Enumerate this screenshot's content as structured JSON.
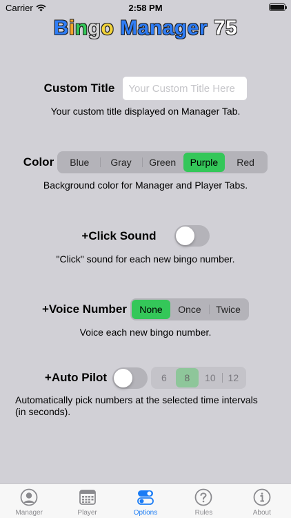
{
  "status_bar": {
    "carrier": "Carrier",
    "time": "2:58 PM"
  },
  "app_title": {
    "word1_letters": [
      {
        "char": "B",
        "color": "#2f7df6"
      },
      {
        "char": "i",
        "color": "#f4a52b"
      },
      {
        "char": "n",
        "color": "#34c759"
      },
      {
        "char": "g",
        "color": "#d5d5d5"
      },
      {
        "char": "o",
        "color": "#f2d33a"
      }
    ],
    "word2": "Manager",
    "word2_color": "#2f7df6",
    "number": "75"
  },
  "custom_title": {
    "label": "Custom Title",
    "placeholder": "Your Custom Title Here",
    "value": "",
    "description": "Your custom title displayed on Manager Tab."
  },
  "color": {
    "label": "Color",
    "options": [
      "Blue",
      "Gray",
      "Green",
      "Purple",
      "Red"
    ],
    "selected": "Purple",
    "description": "Background color for Manager and Player Tabs."
  },
  "click_sound": {
    "label": "+Click Sound",
    "enabled": false,
    "description": "\"Click\" sound for each new bingo number."
  },
  "voice_number": {
    "label": "+Voice Number",
    "options": [
      "None",
      "Once",
      "Twice"
    ],
    "selected": "None",
    "description": "Voice each new bingo number."
  },
  "auto_pilot": {
    "label": "+Auto Pilot",
    "enabled": false,
    "intervals": [
      "6",
      "8",
      "10",
      "12"
    ],
    "selected": "8",
    "description_line1": "Automatically pick numbers at the selected time intervals",
    "description_line2": "(in seconds)."
  },
  "tab_bar": {
    "active": "Options",
    "tabs": [
      {
        "label": "Manager",
        "icon": "person-circle-icon"
      },
      {
        "label": "Player",
        "icon": "calendar-grid-icon"
      },
      {
        "label": "Options",
        "icon": "switches-icon"
      },
      {
        "label": "Rules",
        "icon": "question-circle-icon"
      },
      {
        "label": "About",
        "icon": "info-circle-icon"
      }
    ]
  },
  "colors": {
    "background": "#d1d0d6",
    "selected_segment": "#34c759",
    "tab_active": "#1a7cf5",
    "tab_inactive": "#8a8a8e"
  }
}
